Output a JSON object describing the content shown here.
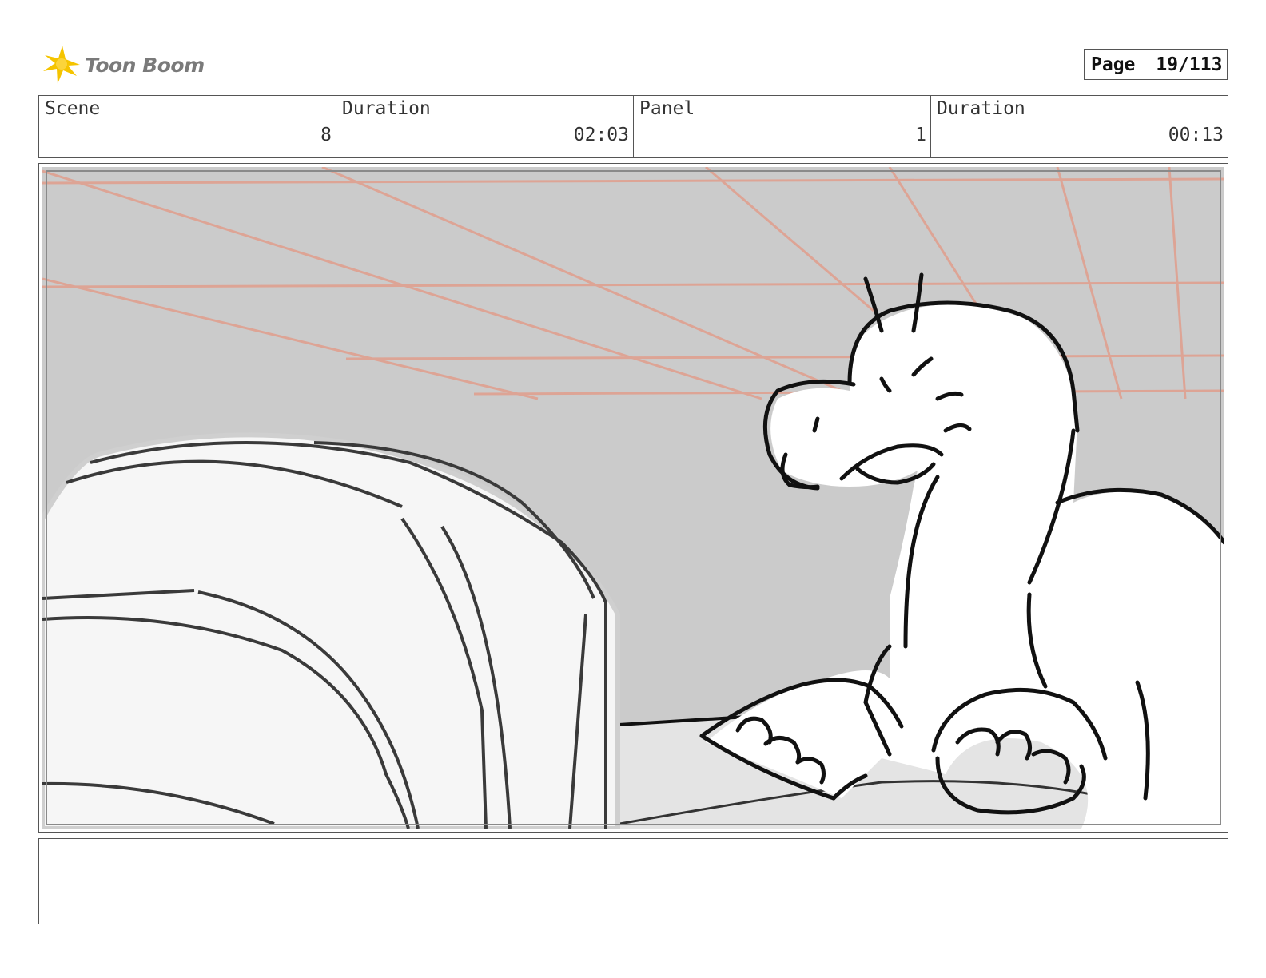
{
  "header": {
    "logo_text": "Toon Boom",
    "page_label": "Page",
    "page_value": "19/113"
  },
  "info": {
    "scene_label": "Scene",
    "scene_value": "8",
    "scene_duration_label": "Duration",
    "scene_duration_value": "02:03",
    "panel_label": "Panel",
    "panel_value": "1",
    "panel_duration_label": "Duration",
    "panel_duration_value": "00:13"
  },
  "caption": {
    "text": ""
  },
  "colors": {
    "logo_yellow": "#f5c400",
    "background_gray": "#cbcbcb",
    "perspective_lines": "#e0a090"
  }
}
